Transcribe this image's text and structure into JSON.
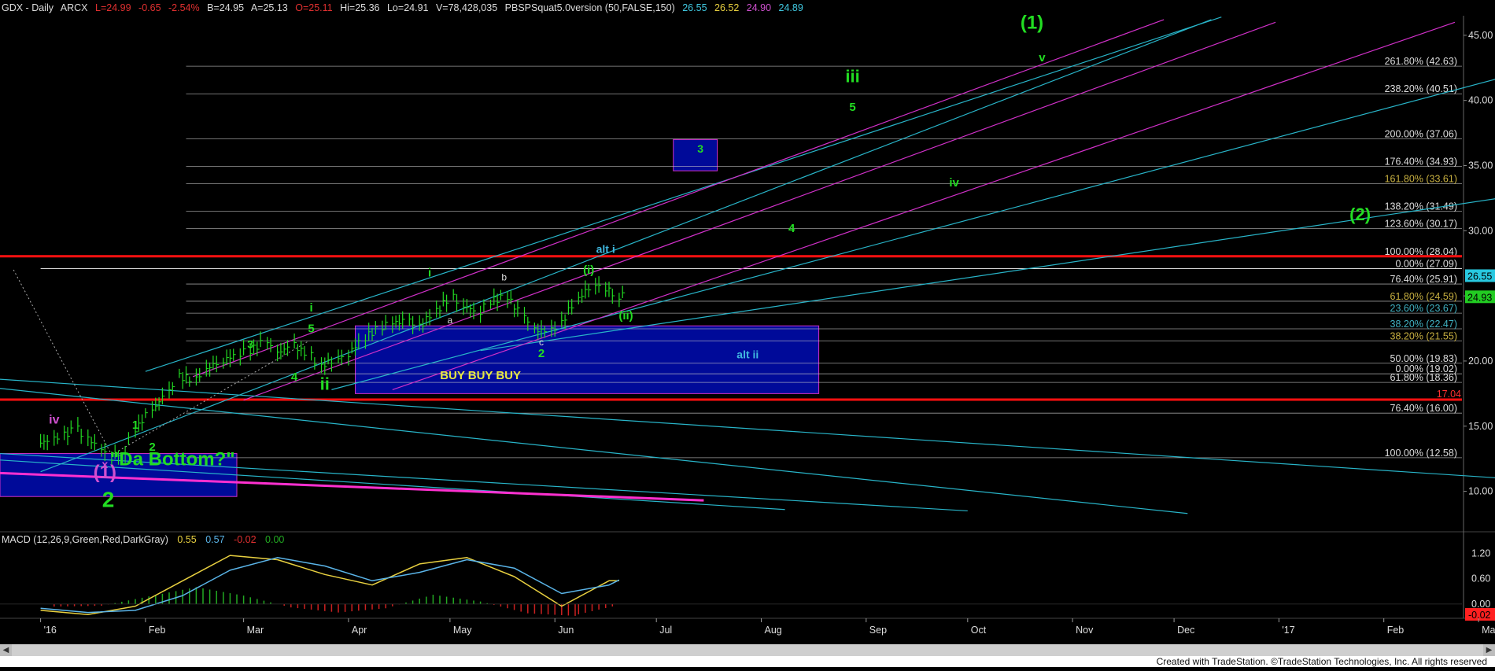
{
  "header": {
    "symbol": "GDX - Daily",
    "exchange": "ARCX",
    "last": "L=24.99",
    "change": "-0.65",
    "change_pct": "-2.54%",
    "bid": "B=24.95",
    "ask": "A=25.13",
    "open": "O=25.11",
    "high": "Hi=25.36",
    "low": "Lo=24.91",
    "volume": "V=78,428,035",
    "study": "PBSPSquat5.0version (50,FALSE,150)",
    "study_values": [
      "26.55",
      "26.52",
      "24.90",
      "24.89"
    ]
  },
  "macd_header": {
    "name": "MACD (12,26,9,Green,Red,DarkGray)",
    "values": [
      "0.55",
      "0.57",
      "-0.02",
      "0.00"
    ]
  },
  "footer": "Created with TradeStation. ©TradeStation Technologies, Inc. All rights reserved",
  "colors": {
    "background": "#000000",
    "price_bars": "#22dd22",
    "fib_lines": "#cccccc",
    "channel_cyan": "#28b4c8",
    "channel_magenta": "#d030c8",
    "support_red": "#ff1010",
    "box_blue": "#000a99",
    "labels_green": "#22dd22",
    "labels_yellow": "#e8e840",
    "macd_fast": "#5ab4e8",
    "macd_slow": "#e8d040",
    "hist_pos": "#22aa22",
    "hist_neg": "#cc2020"
  },
  "chart_data": [
    {
      "type": "line",
      "title": "",
      "x_axis_labels": [
        "'16",
        "Feb",
        "Mar",
        "Apr",
        "May",
        "Jun",
        "Jul",
        "Aug",
        "Sep",
        "Oct",
        "Nov",
        "Dec",
        "'17",
        "Feb",
        "Mar"
      ],
      "y_axis_labels": [
        "10.00",
        "15.00",
        "20.00",
        "25.00",
        "30.00",
        "35.00",
        "40.00",
        "45.00"
      ],
      "ylim": [
        7.5,
        46.5
      ],
      "price_tags": [
        {
          "value": 26.55,
          "label": "26.55"
        },
        {
          "value": 24.93,
          "label": "24.93"
        },
        {
          "value": 17.04,
          "label": "17.04"
        }
      ],
      "series": [
        {
          "x": [
            "2016-01-01",
            "2016-01-05",
            "2016-01-08",
            "2016-01-12",
            "2016-01-15",
            "2016-01-19",
            "2016-01-22",
            "2016-01-26",
            "2016-01-29",
            "2016-02-03",
            "2016-02-08",
            "2016-02-11",
            "2016-02-16",
            "2016-02-19",
            "2016-02-24",
            "2016-02-29",
            "2016-03-03",
            "2016-03-08",
            "2016-03-11",
            "2016-03-16",
            "2016-03-21",
            "2016-03-24",
            "2016-03-29",
            "2016-04-01",
            "2016-04-06",
            "2016-04-11",
            "2016-04-14",
            "2016-04-19",
            "2016-04-22",
            "2016-04-27",
            "2016-05-02",
            "2016-05-05",
            "2016-05-10",
            "2016-05-13",
            "2016-05-18",
            "2016-05-23",
            "2016-05-26",
            "2016-05-31",
            "2016-06-03",
            "2016-06-08",
            "2016-06-13",
            "2016-06-16",
            "2016-06-20"
          ],
          "values": [
            13.7,
            14.0,
            14.3,
            14.8,
            14.1,
            13.3,
            12.6,
            13.1,
            14.7,
            16.2,
            17.6,
            18.8,
            18.6,
            19.4,
            20.0,
            20.6,
            20.8,
            21.5,
            20.6,
            21.2,
            20.4,
            19.6,
            20.2,
            20.5,
            21.8,
            22.6,
            22.9,
            23.1,
            22.6,
            23.8,
            25.0,
            24.2,
            23.8,
            24.6,
            24.9,
            23.5,
            22.4,
            22.3,
            22.9,
            24.8,
            25.9,
            25.6,
            24.99
          ]
        }
      ],
      "horizontal_levels": [
        {
          "value": 42.63,
          "label": "261.80% (42.63)"
        },
        {
          "value": 40.51,
          "label": "238.20% (40.51)"
        },
        {
          "value": 37.06,
          "label": "200.00% (37.06)"
        },
        {
          "value": 34.93,
          "label": "176.40% (34.93)"
        },
        {
          "value": 33.61,
          "label": "161.80% (33.61)"
        },
        {
          "value": 31.49,
          "label": "138.20% (31.49)"
        },
        {
          "value": 30.17,
          "label": "123.60% (30.17)"
        },
        {
          "value": 28.04,
          "label": "100.00% (28.04)"
        },
        {
          "value": 27.09,
          "label": "0.00% (27.09)"
        },
        {
          "value": 25.91,
          "label": "76.40% (25.91)"
        },
        {
          "value": 24.59,
          "label": "61.80% (24.59)"
        },
        {
          "value": 23.67,
          "label": "23.60% (23.67)"
        },
        {
          "value": 22.47,
          "label": "38.20% (22.47)"
        },
        {
          "value": 21.55,
          "label": "38.20% (21.55)"
        },
        {
          "value": 19.83,
          "label": "50.00% (19.83)"
        },
        {
          "value": 19.02,
          "label": "0.00% (19.02)"
        },
        {
          "value": 18.36,
          "label": "61.80% (18.36)"
        },
        {
          "value": 16.0,
          "label": "76.40% (16.00)"
        },
        {
          "value": 12.58,
          "label": "100.00% (12.58)"
        }
      ],
      "annotations": [
        {
          "text": "(1)",
          "x": "2016-10-20",
          "y": 45.5
        },
        {
          "text": "v",
          "x": "2016-10-23",
          "y": 43.0
        },
        {
          "text": "iii",
          "x": "2016-08-28",
          "y": 41.4
        },
        {
          "text": "5",
          "x": "2016-08-28",
          "y": 39.2
        },
        {
          "text": "3",
          "x": "2016-07-14",
          "y": 36.0
        },
        {
          "text": "iv",
          "x": "2016-09-27",
          "y": 33.4
        },
        {
          "text": "4",
          "x": "2016-08-10",
          "y": 29.9
        },
        {
          "text": "(2)",
          "x": "2017-01-25",
          "y": 30.8
        },
        {
          "text": "alt i",
          "x": "2016-06-16",
          "y": 28.3
        },
        {
          "text": "i",
          "x": "2016-04-25",
          "y": 26.5
        },
        {
          "text": "b",
          "x": "2016-05-17",
          "y": 26.2
        },
        {
          "text": "(i)",
          "x": "2016-06-11",
          "y": 26.7
        },
        {
          "text": "a",
          "x": "2016-05-01",
          "y": 22.9
        },
        {
          "text": "(ii)",
          "x": "2016-06-22",
          "y": 23.2
        },
        {
          "text": "c",
          "x": "2016-05-28",
          "y": 21.2
        },
        {
          "text": "2",
          "x": "2016-05-28",
          "y": 20.3
        },
        {
          "text": "alt ii",
          "x": "2016-07-28",
          "y": 20.2
        },
        {
          "text": "BUY  BUY   BUY",
          "x": "2016-05-10",
          "y": 18.6
        },
        {
          "text": "i",
          "x": "2016-03-21",
          "y": 23.8
        },
        {
          "text": "5",
          "x": "2016-03-21",
          "y": 22.2
        },
        {
          "text": "3",
          "x": "2016-03-03",
          "y": 21.0
        },
        {
          "text": "4",
          "x": "2016-03-16",
          "y": 18.5
        },
        {
          "text": "ii",
          "x": "2016-03-25",
          "y": 17.8
        },
        {
          "text": "iv",
          "x": "2016-01-05",
          "y": 15.2
        },
        {
          "text": "1",
          "x": "2016-01-29",
          "y": 14.8
        },
        {
          "text": "2",
          "x": "2016-02-03",
          "y": 13.1
        },
        {
          "text": "\"Da Bottom?\"",
          "x": "2016-02-09",
          "y": 12.0
        },
        {
          "text": "x",
          "x": "2016-01-20",
          "y": 11.8
        },
        {
          "text": "(1)",
          "x": "2016-01-20",
          "y": 11.0
        },
        {
          "text": "2",
          "x": "2016-01-21",
          "y": 8.8
        }
      ]
    },
    {
      "type": "line",
      "title": "",
      "y_axis_labels": [
        "1.20",
        "0.60",
        "0.00"
      ],
      "ylim": [
        -0.3,
        1.45
      ],
      "price_tags": [
        {
          "value": -0.02,
          "label": "-0.02"
        }
      ],
      "series": [
        {
          "x": [
            "2016-01-01",
            "2016-01-15",
            "2016-01-29",
            "2016-02-12",
            "2016-02-26",
            "2016-03-11",
            "2016-03-25",
            "2016-04-08",
            "2016-04-22",
            "2016-05-06",
            "2016-05-20",
            "2016-06-03",
            "2016-06-17",
            "2016-06-20"
          ],
          "values": [
            -0.15,
            -0.25,
            -0.05,
            0.55,
            1.15,
            1.05,
            0.7,
            0.45,
            0.95,
            1.1,
            0.65,
            -0.05,
            0.55,
            0.55
          ]
        },
        {
          "x": [
            "2016-01-01",
            "2016-01-15",
            "2016-01-29",
            "2016-02-12",
            "2016-02-26",
            "2016-03-11",
            "2016-03-25",
            "2016-04-08",
            "2016-04-22",
            "2016-05-06",
            "2016-05-20",
            "2016-06-03",
            "2016-06-17",
            "2016-06-20"
          ],
          "values": [
            -0.1,
            -0.2,
            -0.15,
            0.2,
            0.8,
            1.1,
            0.9,
            0.55,
            0.75,
            1.05,
            0.85,
            0.25,
            0.45,
            0.57
          ]
        }
      ],
      "histogram": {
        "x": [
          "2016-01-05",
          "2016-01-19",
          "2016-02-02",
          "2016-02-16",
          "2016-03-01",
          "2016-03-15",
          "2016-03-29",
          "2016-04-12",
          "2016-04-26",
          "2016-05-10",
          "2016-05-24",
          "2016-06-07",
          "2016-06-20"
        ],
        "values": [
          -0.06,
          -0.04,
          0.18,
          0.4,
          0.2,
          -0.08,
          -0.2,
          -0.1,
          0.22,
          0.06,
          -0.22,
          -0.28,
          -0.02
        ]
      }
    }
  ]
}
